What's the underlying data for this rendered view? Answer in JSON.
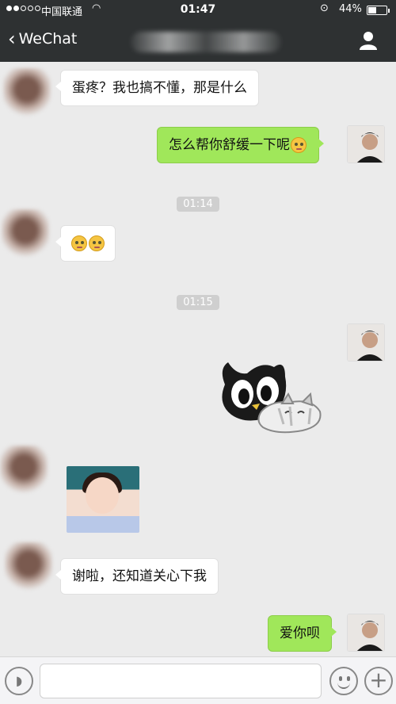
{
  "status_bar": {
    "carrier": "中国联通",
    "wifi_icon": "wifi-icon",
    "time": "01:47",
    "lock_icon": "orientation-lock-icon",
    "battery_percent": "44%",
    "battery_level": 0.44
  },
  "nav": {
    "back_label": "WeChat",
    "profile_icon": "person-icon"
  },
  "messages": [
    {
      "side": "left",
      "text": "蛋疼？我也搞不懂，那是什么"
    },
    {
      "side": "right",
      "text": "怎么帮你舒缓一下呢"
    },
    {
      "timestamp": "01:14"
    },
    {
      "side": "left",
      "emoji": "dizzy-face-emoji"
    },
    {
      "timestamp": "01:15"
    },
    {
      "side": "right",
      "sticker": "black-cat-sticker"
    },
    {
      "side": "left",
      "image": "child-photo"
    },
    {
      "side": "left",
      "text": "谢啦，还知道关心下我"
    },
    {
      "side": "right",
      "text": "爱你呗"
    }
  ],
  "colors": {
    "header_bg": "#2e3132",
    "chat_bg": "#ebebeb",
    "my_bubble": "#a0e75a",
    "their_bubble": "#ffffff"
  },
  "input_bar": {
    "voice_icon": "voice-icon",
    "input_value": "",
    "emoji_icon": "emoji-icon",
    "plus_icon": "plus-icon"
  }
}
